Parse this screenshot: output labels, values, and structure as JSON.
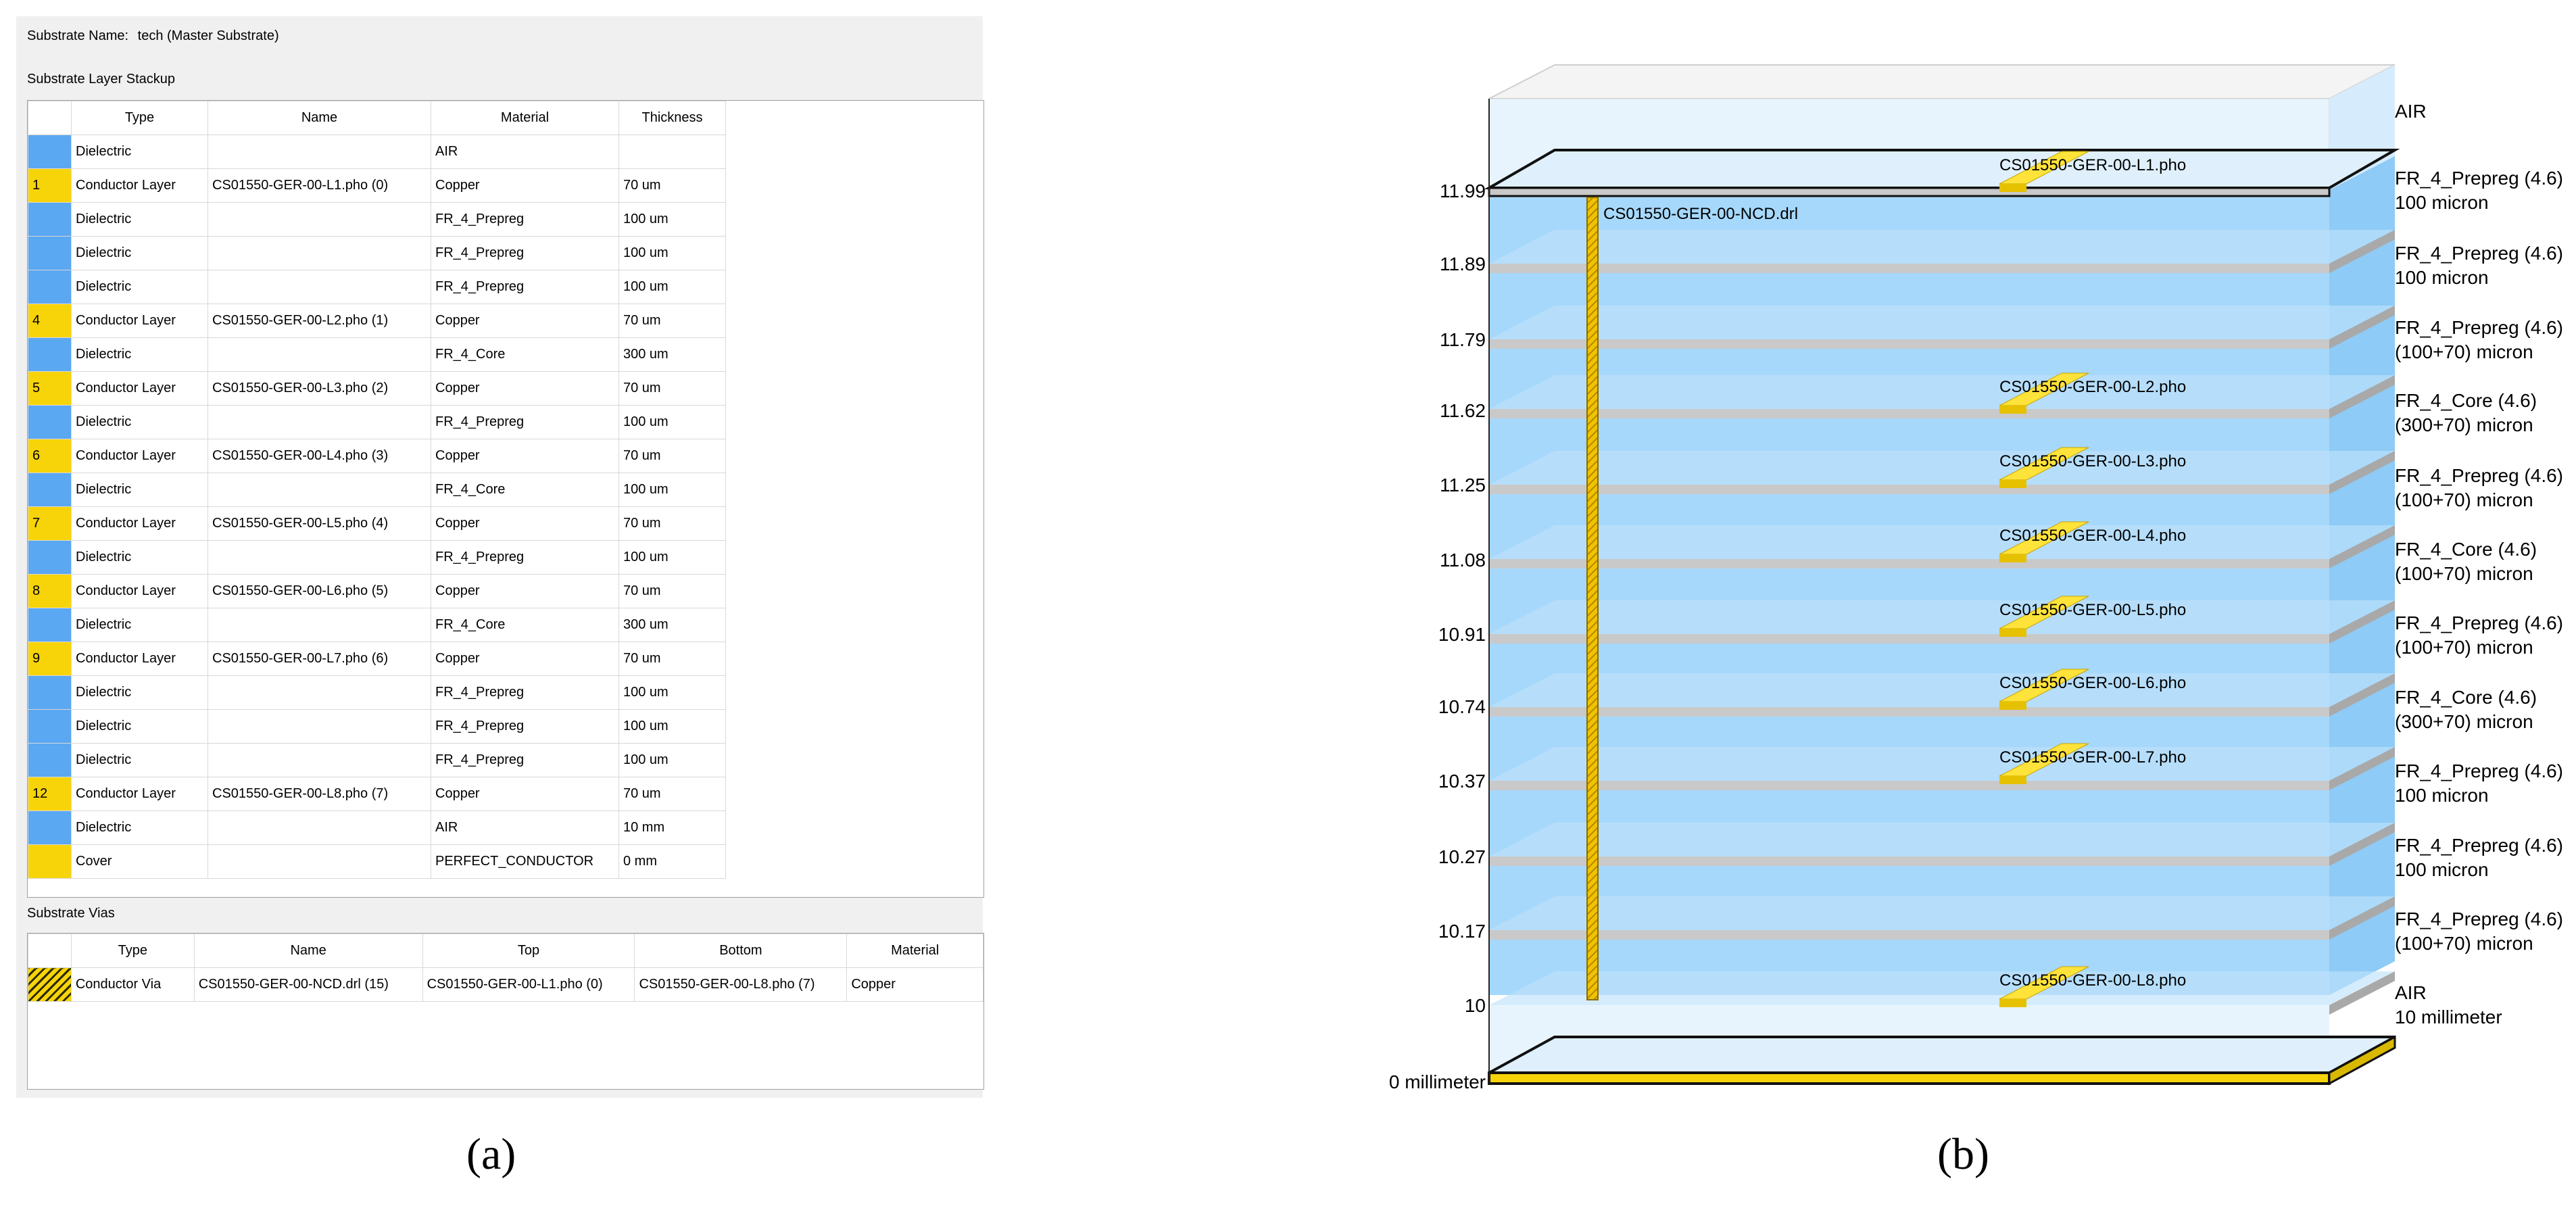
{
  "panel_a": {
    "substrate_name_label": "Substrate Name:",
    "substrate_name_value": "tech (Master Substrate)",
    "stackup_title": "Substrate Layer Stackup",
    "stackup_columns": [
      "Type",
      "Name",
      "Material",
      "Thickness"
    ],
    "stackup_rows": [
      {
        "ind": "",
        "kind": "diel",
        "type": "Dielectric",
        "name": "",
        "material": "AIR",
        "thickness": ""
      },
      {
        "ind": "1",
        "kind": "cond",
        "type": "Conductor Layer",
        "name": "CS01550-GER-00-L1.pho (0)",
        "material": "Copper",
        "thickness": "70 um"
      },
      {
        "ind": "",
        "kind": "diel",
        "type": "Dielectric",
        "name": "",
        "material": "FR_4_Prepreg",
        "thickness": "100 um"
      },
      {
        "ind": "",
        "kind": "diel",
        "type": "Dielectric",
        "name": "",
        "material": "FR_4_Prepreg",
        "thickness": "100 um"
      },
      {
        "ind": "",
        "kind": "diel",
        "type": "Dielectric",
        "name": "",
        "material": "FR_4_Prepreg",
        "thickness": "100 um"
      },
      {
        "ind": "4",
        "kind": "cond",
        "type": "Conductor Layer",
        "name": "CS01550-GER-00-L2.pho (1)",
        "material": "Copper",
        "thickness": "70 um"
      },
      {
        "ind": "",
        "kind": "diel",
        "type": "Dielectric",
        "name": "",
        "material": "FR_4_Core",
        "thickness": "300 um"
      },
      {
        "ind": "5",
        "kind": "cond",
        "type": "Conductor Layer",
        "name": "CS01550-GER-00-L3.pho (2)",
        "material": "Copper",
        "thickness": "70 um"
      },
      {
        "ind": "",
        "kind": "diel",
        "type": "Dielectric",
        "name": "",
        "material": "FR_4_Prepreg",
        "thickness": "100 um"
      },
      {
        "ind": "6",
        "kind": "cond",
        "type": "Conductor Layer",
        "name": "CS01550-GER-00-L4.pho (3)",
        "material": "Copper",
        "thickness": "70 um"
      },
      {
        "ind": "",
        "kind": "diel",
        "type": "Dielectric",
        "name": "",
        "material": "FR_4_Core",
        "thickness": "100 um"
      },
      {
        "ind": "7",
        "kind": "cond",
        "type": "Conductor Layer",
        "name": "CS01550-GER-00-L5.pho (4)",
        "material": "Copper",
        "thickness": "70 um"
      },
      {
        "ind": "",
        "kind": "diel",
        "type": "Dielectric",
        "name": "",
        "material": "FR_4_Prepreg",
        "thickness": "100 um"
      },
      {
        "ind": "8",
        "kind": "cond",
        "type": "Conductor Layer",
        "name": "CS01550-GER-00-L6.pho (5)",
        "material": "Copper",
        "thickness": "70 um"
      },
      {
        "ind": "",
        "kind": "diel",
        "type": "Dielectric",
        "name": "",
        "material": "FR_4_Core",
        "thickness": "300 um"
      },
      {
        "ind": "9",
        "kind": "cond",
        "type": "Conductor Layer",
        "name": "CS01550-GER-00-L7.pho (6)",
        "material": "Copper",
        "thickness": "70 um"
      },
      {
        "ind": "",
        "kind": "diel",
        "type": "Dielectric",
        "name": "",
        "material": "FR_4_Prepreg",
        "thickness": "100 um"
      },
      {
        "ind": "",
        "kind": "diel",
        "type": "Dielectric",
        "name": "",
        "material": "FR_4_Prepreg",
        "thickness": "100 um"
      },
      {
        "ind": "",
        "kind": "diel",
        "type": "Dielectric",
        "name": "",
        "material": "FR_4_Prepreg",
        "thickness": "100 um"
      },
      {
        "ind": "12",
        "kind": "cond",
        "type": "Conductor Layer",
        "name": "CS01550-GER-00-L8.pho (7)",
        "material": "Copper",
        "thickness": "70 um"
      },
      {
        "ind": "",
        "kind": "diel",
        "type": "Dielectric",
        "name": "",
        "material": "AIR",
        "thickness": "10 mm"
      },
      {
        "ind": "",
        "kind": "cover",
        "type": "Cover",
        "name": "",
        "material": "PERFECT_CONDUCTOR",
        "thickness": "0 mm"
      }
    ],
    "vias_title": "Substrate Vias",
    "vias_columns": [
      "Type",
      "Name",
      "Top",
      "Bottom",
      "Material"
    ],
    "vias_rows": [
      {
        "type": "Conductor Via",
        "name": "CS01550-GER-00-NCD.drl (15)",
        "top": "CS01550-GER-00-L1.pho (0)",
        "bottom": "CS01550-GER-00-L8.pho (7)",
        "material": "Copper"
      }
    ],
    "caption": "(a)"
  },
  "panel_b": {
    "z_ticks": [
      "11.99",
      "11.89",
      "11.79",
      "11.62",
      "11.25",
      "11.08",
      "10.91",
      "10.74",
      "10.37",
      "10.27",
      "10.17",
      "10"
    ],
    "z_bottom_label": "0 millimeter",
    "right_labels": [
      {
        "l1": "AIR",
        "l2": ""
      },
      {
        "l1": "FR_4_Prepreg (4.6)",
        "l2": "100 micron"
      },
      {
        "l1": "FR_4_Prepreg (4.6)",
        "l2": "100 micron"
      },
      {
        "l1": "FR_4_Prepreg (4.6)",
        "l2": "(100+70) micron"
      },
      {
        "l1": "FR_4_Core (4.6)",
        "l2": "(300+70) micron"
      },
      {
        "l1": "FR_4_Prepreg (4.6)",
        "l2": "(100+70) micron"
      },
      {
        "l1": "FR_4_Core (4.6)",
        "l2": "(100+70) micron"
      },
      {
        "l1": "FR_4_Prepreg (4.6)",
        "l2": "(100+70) micron"
      },
      {
        "l1": "FR_4_Core (4.6)",
        "l2": "(300+70) micron"
      },
      {
        "l1": "FR_4_Prepreg (4.6)",
        "l2": "100 micron"
      },
      {
        "l1": "FR_4_Prepreg (4.6)",
        "l2": "100 micron"
      },
      {
        "l1": "FR_4_Prepreg (4.6)",
        "l2": "(100+70) micron"
      },
      {
        "l1": "AIR",
        "l2": "10 millimeter"
      }
    ],
    "conductor_labels": [
      "CS01550-GER-00-L1.pho",
      "CS01550-GER-00-L2.pho",
      "CS01550-GER-00-L3.pho",
      "CS01550-GER-00-L4.pho",
      "CS01550-GER-00-L5.pho",
      "CS01550-GER-00-L6.pho",
      "CS01550-GER-00-L7.pho",
      "CS01550-GER-00-L8.pho"
    ],
    "via_label": "CS01550-GER-00-NCD.drl",
    "caption": "(b)",
    "colors": {
      "dielectric": "#a6d8fb",
      "conductor": "#f7d40a",
      "separator": "#c9c9c9",
      "air": "#e8f4fd"
    }
  }
}
